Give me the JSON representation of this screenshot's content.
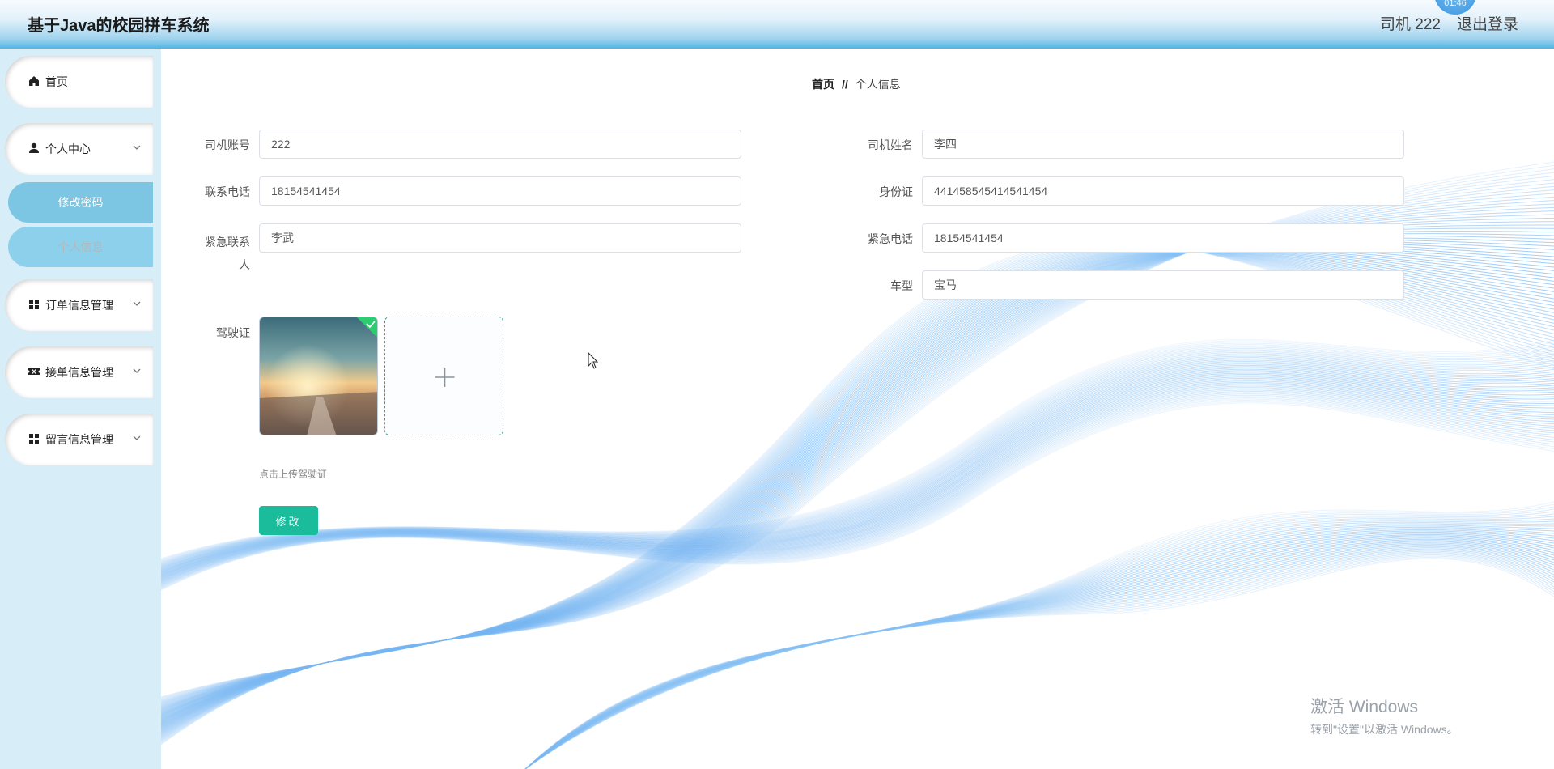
{
  "header": {
    "title": "基于Java的校园拼车系统",
    "user": "司机 222",
    "logout": "退出登录",
    "clock": "01:46"
  },
  "sidebar": {
    "items": [
      {
        "label": "首页",
        "icon": "home-icon"
      },
      {
        "label": "个人中心",
        "icon": "user-icon"
      },
      {
        "label": "订单信息管理",
        "icon": "grid-icon"
      },
      {
        "label": "接单信息管理",
        "icon": "ticket-icon"
      },
      {
        "label": "留言信息管理",
        "icon": "grid-icon"
      }
    ],
    "submenu": [
      {
        "label": "修改密码"
      },
      {
        "label": "个人信息"
      }
    ]
  },
  "breadcrumb": {
    "home": "首页",
    "separator": "//",
    "current": "个人信息"
  },
  "form": {
    "account_label": "司机账号",
    "account_value": "222",
    "name_label": "司机姓名",
    "name_value": "李四",
    "phone_label": "联系电话",
    "phone_value": "18154541454",
    "idcard_label": "身份证",
    "idcard_value": "441458545414541454",
    "emergency_contact_label": "紧急联系人",
    "emergency_contact_value": "李武",
    "emergency_phone_label": "紧急电话",
    "emergency_phone_value": "18154541454",
    "car_label": "车型",
    "car_value": "宝马",
    "license_label": "驾驶证",
    "upload_hint": "点击上传驾驶证",
    "submit_label": "修改"
  },
  "watermark": {
    "line1": "激活 Windows",
    "line2": "转到\"设置\"以激活 Windows。"
  },
  "colors": {
    "accent": "#1abc9c",
    "sidebar_bg": "#d7edf7",
    "submenu": "#7cc6e3",
    "wave": "#2e8ff0"
  }
}
